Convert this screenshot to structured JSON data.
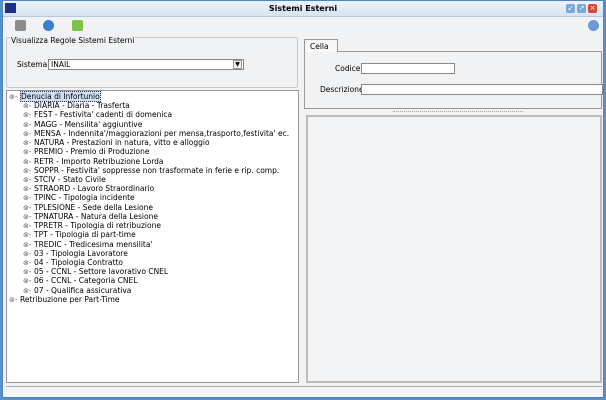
{
  "window": {
    "title": "Sistemi Esterni"
  },
  "toolbar": {
    "buttons": [
      "save-icon",
      "refresh-icon",
      "export-icon"
    ],
    "help": "help-icon"
  },
  "filter": {
    "group_title": "Visualizza Regole Sistemi Esterni",
    "sistema_label": "Sistema",
    "sistema_value": "INAIL"
  },
  "tree": {
    "root": "Denucia di Infortunio",
    "children": [
      "DIARIA - Diaria - Trasferta",
      "FEST - Festivita' cadenti di domenica",
      "MAGG - Mensilita' aggiuntive",
      "MENSA - Indennita'/maggiorazioni per mensa,trasporto,festivita' ec.",
      "NATURA - Prestazioni in natura, vitto e alloggio",
      "PREMIO - Premio di Produzione",
      "RETR - Importo Retribuzione Lorda",
      "SOPPR - Festivita' soppresse non trasformate in ferie e rip. comp.",
      "STCIV - Stato Civile",
      "STRAORD - Lavoro Straordinario",
      "TPINC - Tipologia incidente",
      "TPLESIONE - Sede della Lesione",
      "TPNATURA - Natura della Lesione",
      "TPRETR - Tipologia di retribuzione",
      "TPT - Tipologia di part-time",
      "TREDIC - Tredicesima mensilita'",
      "03 - Tipologia Lavoratore",
      "04 - Tipologia Contratto",
      "05 - CCNL - Settore lavorativo CNEL",
      "06 - CCNL - Categoria CNEL",
      "07 - Qualifica assicurativa"
    ],
    "root2": "Retribuzione per Part-Time"
  },
  "detail": {
    "tab": "Cella",
    "codice_label": "Codice",
    "codice_value": "",
    "descrizione_label": "Descrizione",
    "descrizione_value": ""
  }
}
